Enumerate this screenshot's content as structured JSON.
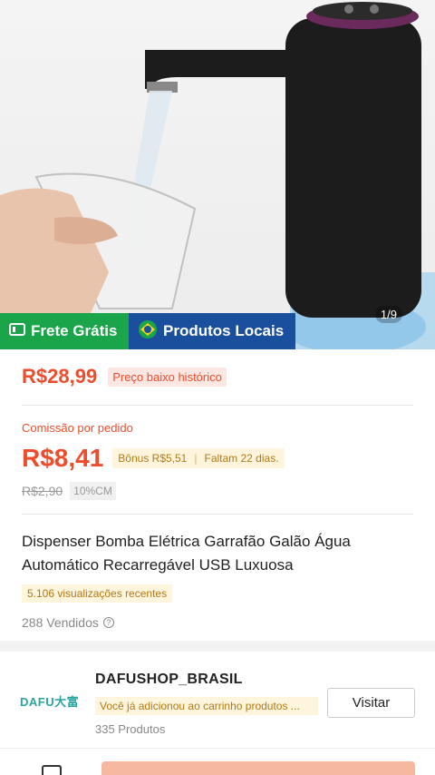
{
  "hero": {
    "image_counter": "1/9",
    "ribbon": {
      "free_shipping": "Frete Grátis",
      "local_products": "Produtos Locais"
    }
  },
  "price": {
    "current": "R$28,99",
    "tag": "Preço baixo histórico"
  },
  "commission": {
    "label": "Comissão por pedido",
    "value": "R$8,41",
    "bonus": "Bônus R$5,51",
    "days_left": "Faltam 22 dias.",
    "old_value": "R$2,90",
    "rate": "10%CM"
  },
  "product": {
    "title": "Dispenser Bomba Elétrica Garrafão Galão Água Automático Recarregável USB Luxuosa",
    "views": "5.106 visualizações recentes",
    "sold": "288 Vendidos"
  },
  "shop": {
    "logo_text": "DAFU大富",
    "name": "DAFUSHOP_BRASIL",
    "note": "Você já adicionou ao carrinho produtos ...",
    "products_count": "335 Produtos",
    "visit_label": "Visitar"
  },
  "colors": {
    "accent": "#ee4d2d",
    "free_green": "#1aa54a",
    "local_blue": "#1a4f9d"
  },
  "icons": [
    "truck-icon",
    "brazil-flag-icon",
    "info-icon",
    "chat-icon"
  ]
}
